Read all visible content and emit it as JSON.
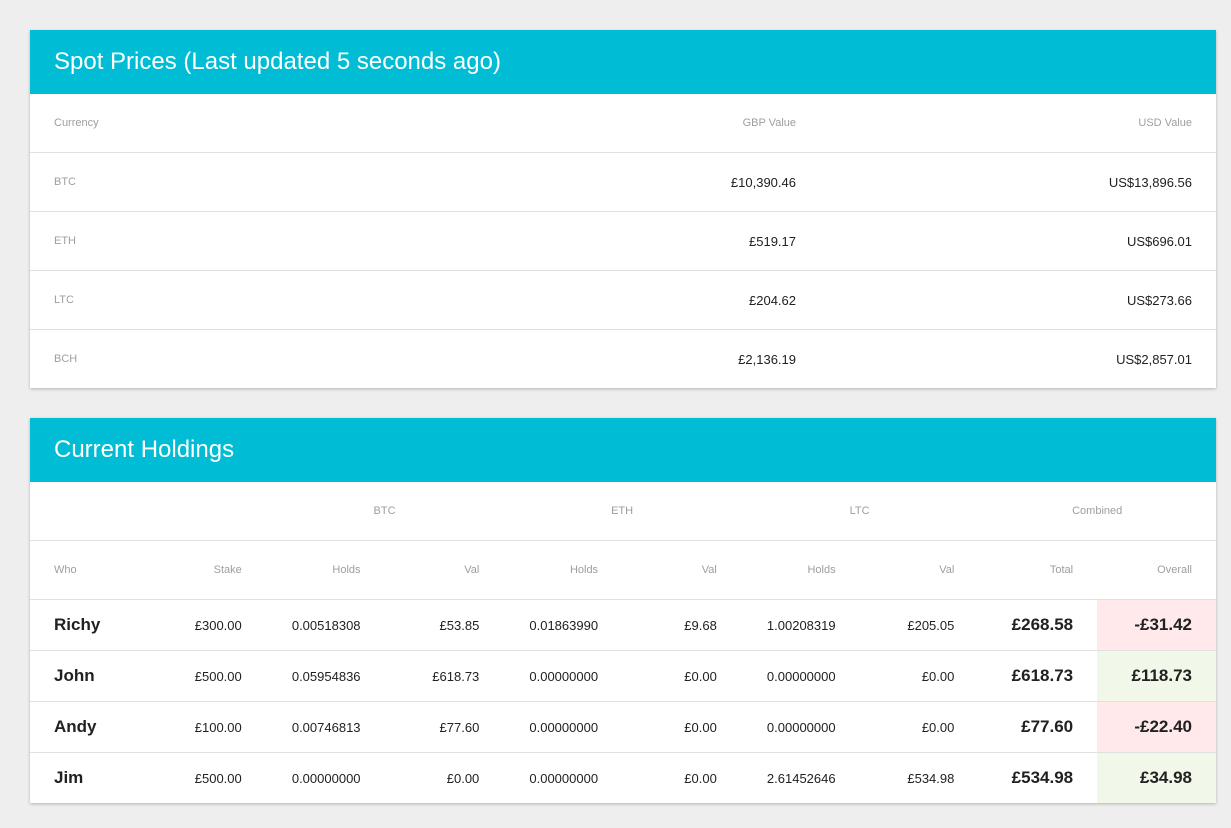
{
  "spot": {
    "title": "Spot Prices (Last updated 5 seconds ago)",
    "headers": [
      "Currency",
      "GBP Value",
      "USD Value"
    ],
    "rows": [
      [
        "BTC",
        "£10,390.46",
        "US$13,896.56"
      ],
      [
        "ETH",
        "£519.17",
        "US$696.01"
      ],
      [
        "LTC",
        "£204.62",
        "US$273.66"
      ],
      [
        "BCH",
        "£2,136.19",
        "US$2,857.01"
      ]
    ]
  },
  "holdings": {
    "title": "Current Holdings",
    "groups": [
      "",
      "BTC",
      "ETH",
      "LTC",
      "Combined"
    ],
    "headers": [
      "Who",
      "Stake",
      "Holds",
      "Val",
      "Holds",
      "Val",
      "Holds",
      "Val",
      "Total",
      "Overall"
    ],
    "rows": [
      {
        "cells": [
          "Richy",
          "£300.00",
          "0.00518308",
          "£53.85",
          "0.01863990",
          "£9.68",
          "1.00208319",
          "£205.05",
          "£268.58",
          "-£31.42"
        ],
        "status": "negative"
      },
      {
        "cells": [
          "John",
          "£500.00",
          "0.05954836",
          "£618.73",
          "0.00000000",
          "£0.00",
          "0.00000000",
          "£0.00",
          "£618.73",
          "£118.73"
        ],
        "status": "positive"
      },
      {
        "cells": [
          "Andy",
          "£100.00",
          "0.00746813",
          "£77.60",
          "0.00000000",
          "£0.00",
          "0.00000000",
          "£0.00",
          "£77.60",
          "-£22.40"
        ],
        "status": "negative"
      },
      {
        "cells": [
          "Jim",
          "£500.00",
          "0.00000000",
          "£0.00",
          "0.00000000",
          "£0.00",
          "2.61452646",
          "£534.98",
          "£534.98",
          "£34.98"
        ],
        "status": "positive"
      }
    ]
  },
  "colors": {
    "header": "#00bcd4",
    "negative": "#ffe9eb",
    "positive": "#f1f8e9"
  }
}
